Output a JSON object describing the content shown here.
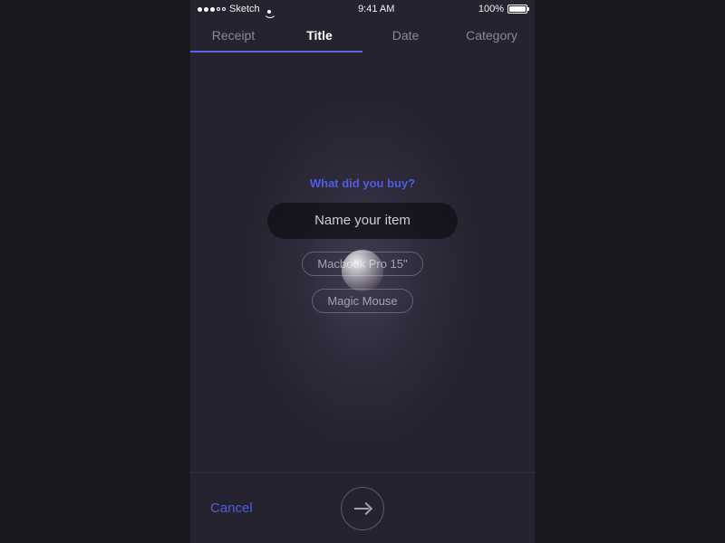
{
  "statusbar": {
    "carrier": "Sketch",
    "time": "9:41 AM",
    "battery_pct": "100%"
  },
  "tabs": {
    "items": [
      {
        "label": "Receipt"
      },
      {
        "label": "Title"
      },
      {
        "label": "Date"
      },
      {
        "label": "Category"
      }
    ],
    "active_index": 1
  },
  "main": {
    "prompt": "What did you buy?",
    "input_placeholder": "Name your item",
    "input_value": "",
    "suggestions": [
      {
        "label": "Macbook Pro 15\""
      },
      {
        "label": "Magic Mouse"
      }
    ]
  },
  "footer": {
    "cancel_label": "Cancel"
  },
  "colors": {
    "accent": "#4d5fe0",
    "underline": "#5b62e0"
  }
}
